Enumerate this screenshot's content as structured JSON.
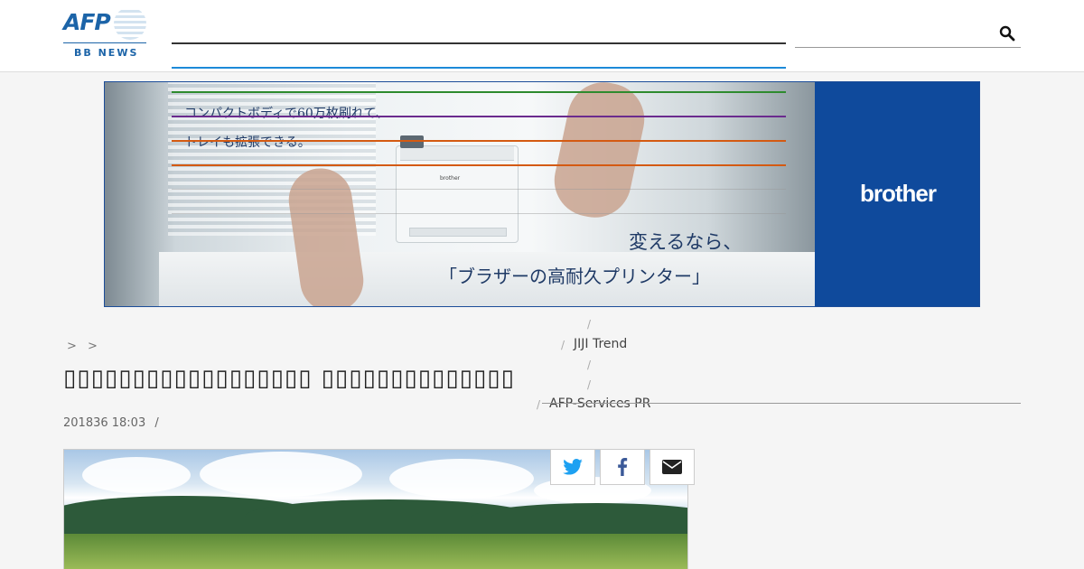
{
  "header": {
    "logo_text": "AFP",
    "logo_sub": "BB NEWS",
    "search_placeholder": ""
  },
  "banner": {
    "copy_line1": "コンパクトボディで60万枚刷れて、",
    "copy_line2": "トレイも拡張できる。",
    "headline_line1": "変えるなら、",
    "headline_line2": "「ブラザーの高耐久プリンター」",
    "brand": "brother",
    "printer_label": "brother"
  },
  "menu": {
    "sep": "/",
    "link_jiji": "JIJI Trend",
    "link_afp_services": "AFP-Services PR"
  },
  "breadcrumb": {
    "sep1": ">",
    "sep2": ">"
  },
  "article": {
    "title": "▯▯▯▯▯▯▯▯▯▯▯▯▯▯▯▯▯▯ ▯▯▯▯▯▯▯▯▯▯▯▯▯▯",
    "date": "201836 18:03",
    "date_sep": "/"
  },
  "colors": {
    "brand_blue": "#1c64a8",
    "banner_brand_bg": "#0f4a9c",
    "twitter": "#1da1f2",
    "facebook": "#3b5998"
  }
}
